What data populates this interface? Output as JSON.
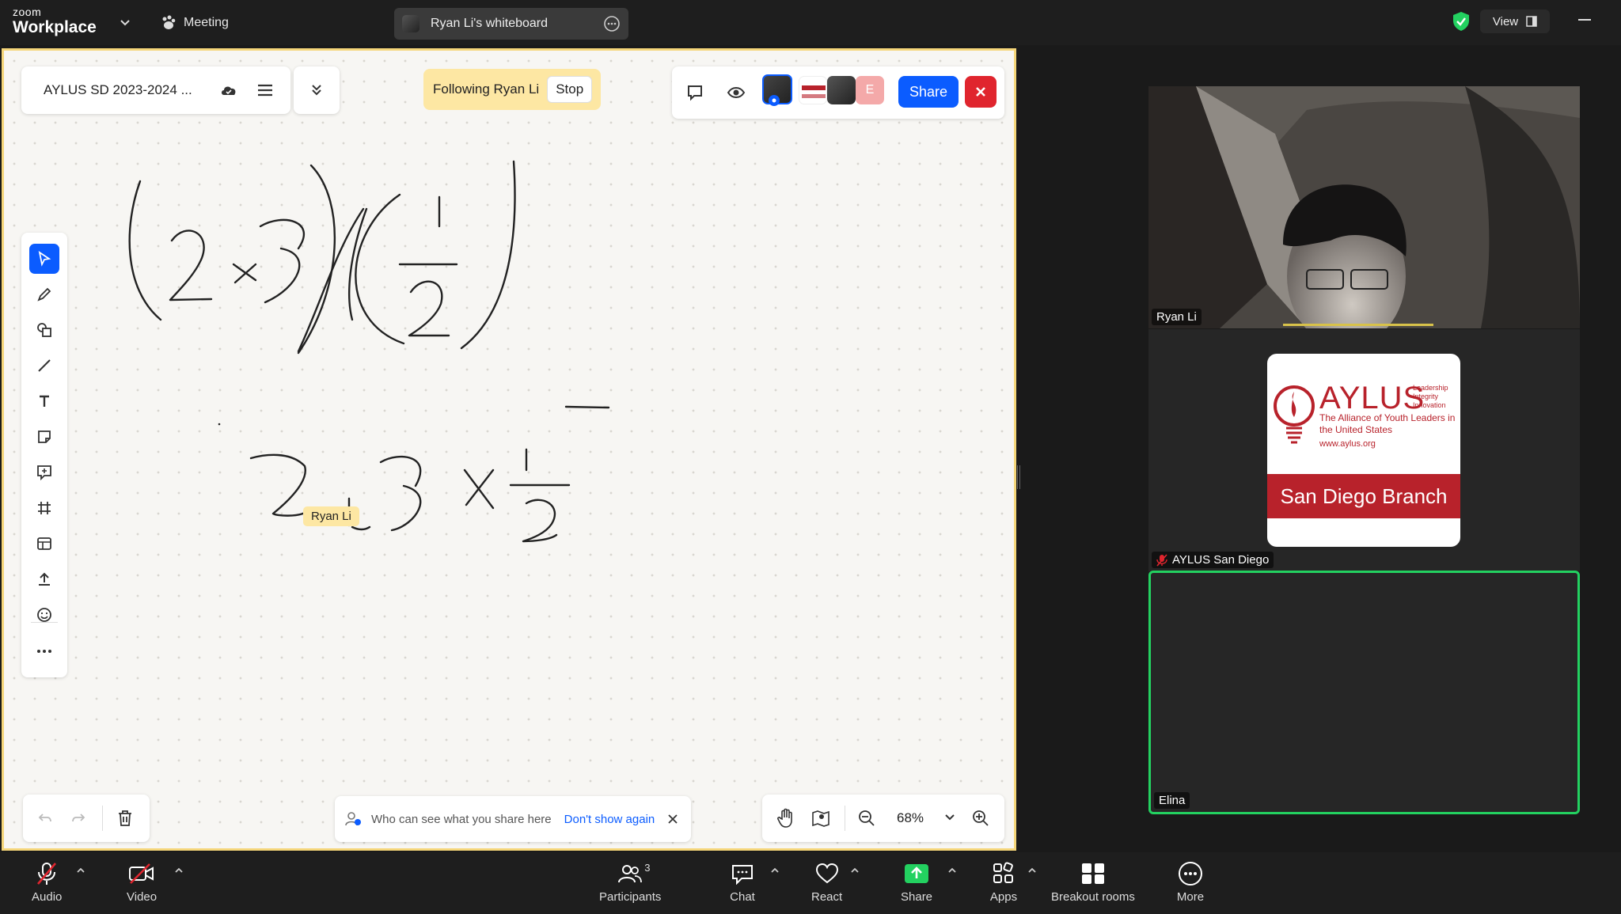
{
  "titlebar": {
    "brand_top": "zoom",
    "brand_bottom": "Workplace",
    "meeting_label": "Meeting",
    "share_pill_title": "Ryan Li's whiteboard",
    "view_label": "View"
  },
  "whiteboard": {
    "file_title": "AYLUS SD 2023-2024 ...",
    "following_text": "Following Ryan Li",
    "stop_label": "Stop",
    "share_label": "Share",
    "avatar_initial": "E",
    "cursor_label": "Ryan Li",
    "hint_text": "Who can see what you share here",
    "hint_dismiss": "Don't show again",
    "zoom_level": "68%",
    "tools": [
      "select-tool",
      "pen-tool",
      "shapes-tool",
      "line-tool",
      "text-tool",
      "sticky-note-tool",
      "comment-tool",
      "frame-tool",
      "template-tool",
      "upload-tool",
      "reaction-tool",
      "more-tools"
    ]
  },
  "participants_panel": {
    "tile1_name": "Ryan Li",
    "tile2_name": "AYLUS San Diego",
    "tile3_name": "Elina",
    "logo": {
      "name": "AYLUS",
      "tagline_1": "Leadership",
      "tagline_2": "Integrity",
      "tagline_3": "Innovation",
      "sub": "The Alliance of Youth Leaders in the United States",
      "url": "www.aylus.org",
      "band": "San Diego Branch"
    }
  },
  "bottombar": {
    "audio": "Audio",
    "video": "Video",
    "participants": "Participants",
    "participants_count": "3",
    "chat": "Chat",
    "react": "React",
    "share": "Share",
    "apps": "Apps",
    "breakout": "Breakout rooms",
    "more": "More"
  },
  "colors": {
    "accent": "#0b5cff",
    "whiteboard_border": "#f5d67a",
    "follow_bg": "#fde7a3",
    "active_speaker": "#23d160",
    "close_red": "#e0252e",
    "share_green": "#23d160",
    "brand_red": "#b8222b"
  }
}
